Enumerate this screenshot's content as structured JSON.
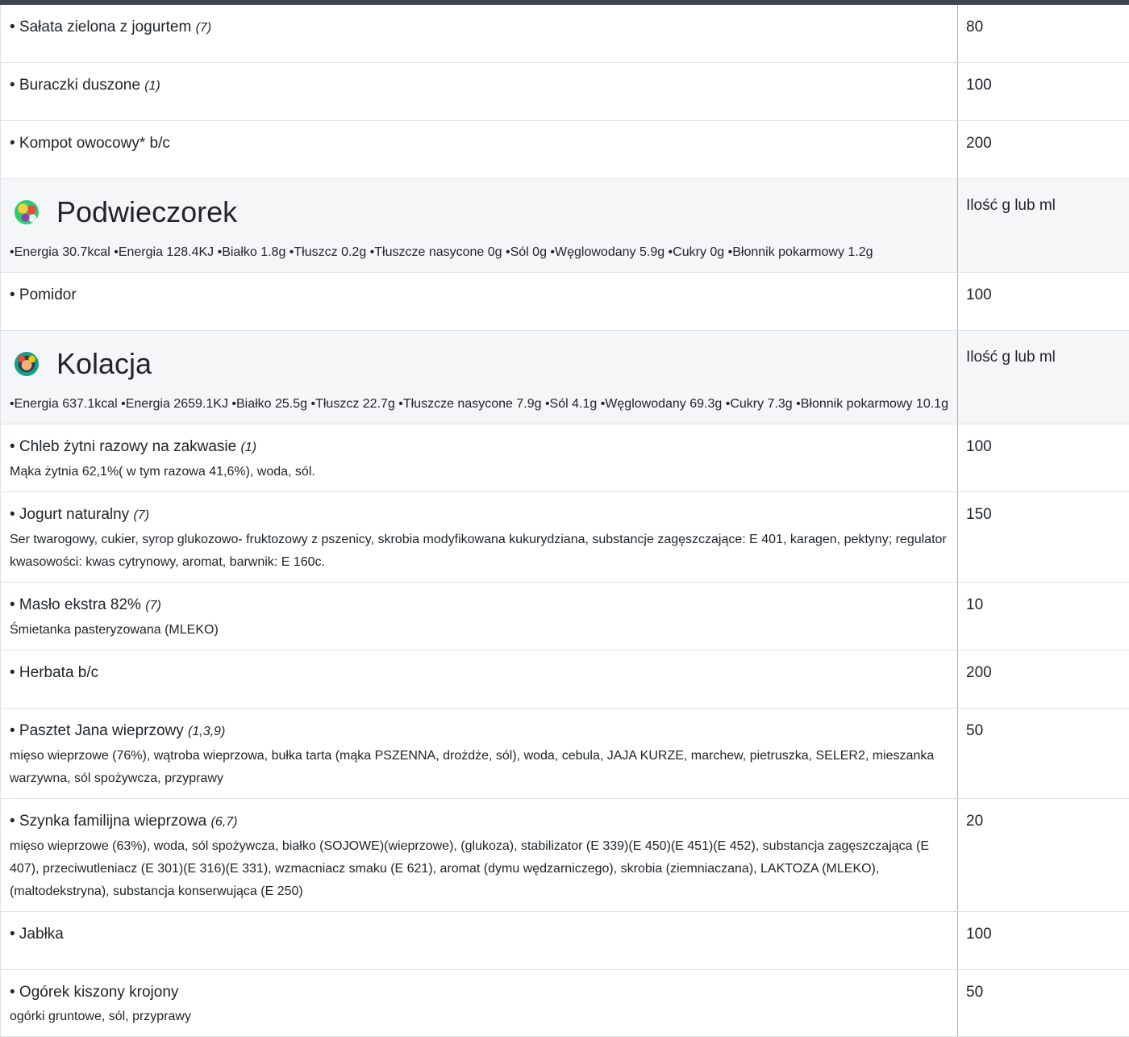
{
  "items_top": [
    {
      "name": "• Sałata zielona z jogurtem",
      "allergens": "(7)",
      "qty": "80"
    },
    {
      "name": "• Buraczki duszone",
      "allergens": "(1)",
      "qty": "100"
    },
    {
      "name": "• Kompot owocowy* b/c",
      "allergens": "",
      "qty": "200"
    }
  ],
  "podwieczorek": {
    "title": "Podwieczorek",
    "icon": "fruit-bowl-icon",
    "qty_header": "Ilość g lub ml",
    "nutrition": "•Energia 30.7kcal •Energia 128.4KJ •Białko 1.8g •Tłuszcz 0.2g •Tłuszcze nasycone 0g •Sól 0g •Węglowodany 5.9g •Cukry 0g •Błonnik pokarmowy 1.2g",
    "items": [
      {
        "name": "• Pomidor",
        "allergens": "",
        "qty": "100"
      }
    ]
  },
  "kolacja": {
    "title": "Kolacja",
    "icon": "dinner-plate-icon",
    "qty_header": "Ilość g lub ml",
    "nutrition": "•Energia 637.1kcal •Energia 2659.1KJ •Białko 25.5g •Tłuszcz 22.7g •Tłuszcze nasycone 7.9g •Sól 4.1g •Węglowodany 69.3g •Cukry 7.3g •Błonnik pokarmowy 10.1g",
    "items": [
      {
        "name": "• Chleb żytni razowy na zakwasie",
        "allergens": "(1)",
        "qty": "100",
        "desc": "Mąka żytnia 62,1%( w tym razowa 41,6%), woda, sól."
      },
      {
        "name": "• Jogurt naturalny",
        "allergens": "(7)",
        "qty": "150",
        "desc": "Ser twarogowy, cukier, syrop glukozowo- fruktozowy z pszenicy, skrobia modyfikowana kukurydziana, substancje zagęszczające: E 401, karagen, pektyny; regulator kwasowości: kwas cytrynowy, aromat, barwnik: E 160c."
      },
      {
        "name": "• Masło ekstra 82%",
        "allergens": "(7)",
        "qty": "10",
        "desc": "Śmietanka pasteryzowana (MLEKO)"
      },
      {
        "name": "• Herbata b/c",
        "allergens": "",
        "qty": "200"
      },
      {
        "name": "• Pasztet Jana wieprzowy",
        "allergens": "(1,3,9)",
        "qty": "50",
        "desc": "mięso wieprzowe (76%), wątroba wieprzowa, bułka tarta (mąka PSZENNA, drożdże, sól), woda, cebula, JAJA KURZE, marchew, pietruszka, SELER2, mieszanka warzywna, sól spożywcza, przyprawy"
      },
      {
        "name": "• Szynka familijna wieprzowa",
        "allergens": "(6,7)",
        "qty": "20",
        "desc": "mięso wieprzowe (63%), woda, sól spożywcza, białko (SOJOWE)(wieprzowe), (glukoza), stabilizator (E 339)(E 450)(E 451)(E 452), substancja zagęszczająca (E 407), przeciwutleniacz (E 301)(E 316)(E 331), wzmacniacz smaku (E 621), aromat (dymu wędzarniczego), skrobia (ziemniaczana), LAKTOZA (MLEKO), (maltodekstryna), substancja konserwująca (E 250)"
      },
      {
        "name": "• Jabłka",
        "allergens": "",
        "qty": "100"
      },
      {
        "name": "• Ogórek kiszony krojony",
        "allergens": "",
        "qty": "50",
        "desc": "ogórki gruntowe, sól, przyprawy"
      }
    ]
  }
}
